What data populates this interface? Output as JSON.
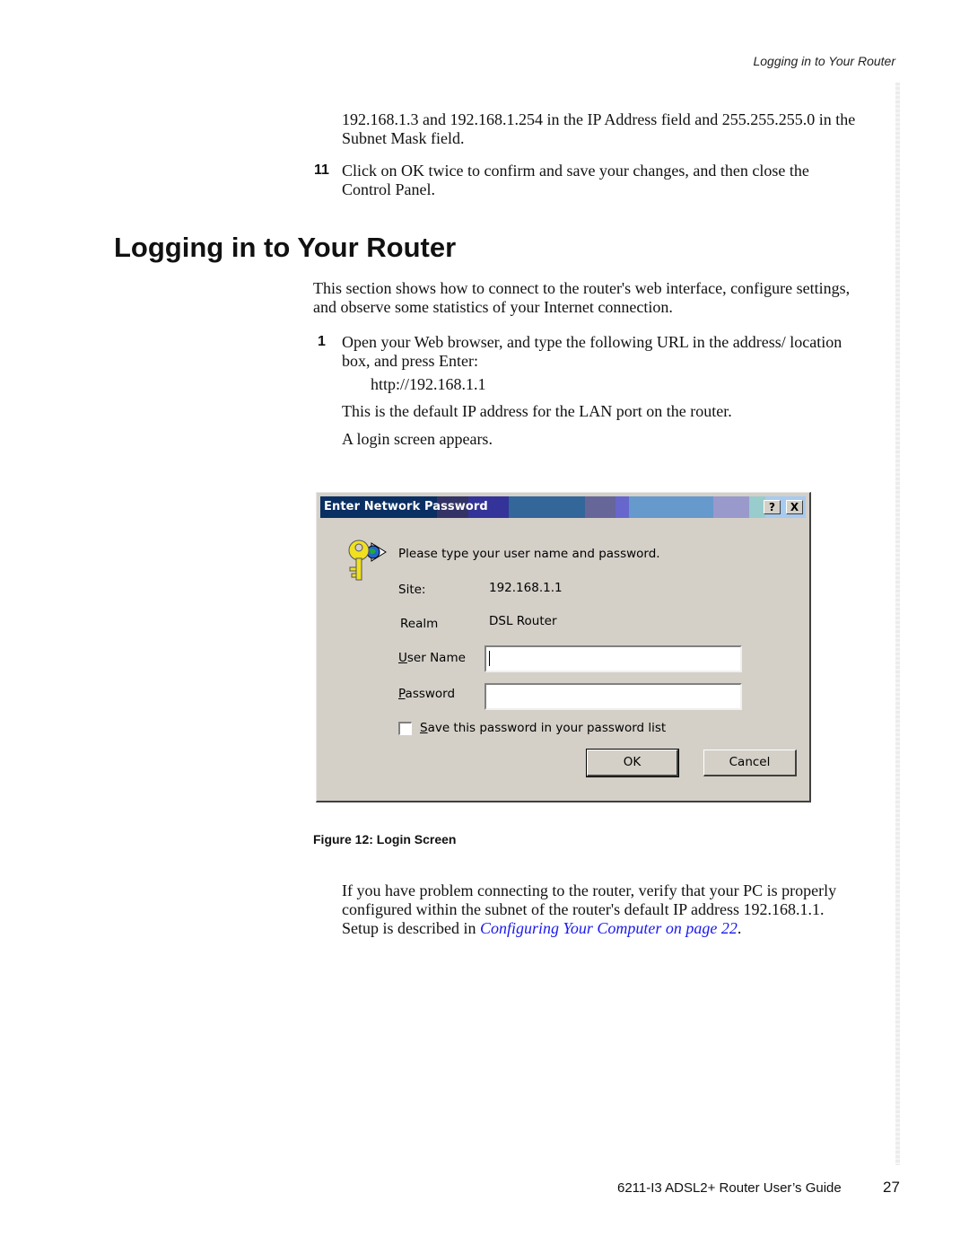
{
  "running_head": "Logging in to Your Router",
  "prev_section": {
    "continuation": "192.168.1.3 and 192.168.1.254 in the IP Address field and 255.255.255.0 in the Subnet Mask field.",
    "step_11": {
      "number": "11",
      "text": "Click on OK twice to confirm and save your changes, and then close the Control Panel."
    }
  },
  "section": {
    "title": "Logging in to Your Router",
    "intro": "This section shows how to connect to the router's web interface, configure settings, and observe some statistics of your Internet connection.",
    "step_1": {
      "number": "1",
      "text": "Open your Web browser, and type the following URL in the address/ location box, and press Enter:",
      "url": "http://192.168.1.1",
      "note1": "This is the default IP address for the LAN port on the router.",
      "note2": "A login screen appears."
    }
  },
  "dialog": {
    "title": "Enter Network Password",
    "help_button": "?",
    "close_button": "X",
    "prompt": "Please type your user name and password.",
    "site_label": "Site:",
    "site_value": "192.168.1.1",
    "realm_label": "Realm",
    "realm_value": "DSL Router",
    "username_label_u": "U",
    "username_label_rest": "ser Name",
    "username_value": "",
    "password_label_u": "P",
    "password_label_rest": "assword",
    "password_value": "",
    "save_label_u": "S",
    "save_label_rest": "ave this password in your password list",
    "save_checked": false,
    "ok_label": "OK",
    "cancel_label": "Cancel",
    "icon": "key-globe-icon"
  },
  "figure_caption": "Figure 12: Login Screen",
  "trouble": {
    "text_before": "If you have problem connecting to the router, verify that your PC is properly configured within the subnet of the router's default IP address 192.168.1.1. Setup is described in ",
    "link": "Configuring Your Computer on page 22",
    "text_after": "."
  },
  "footer": {
    "guide_title": "6211-I3 ADSL2+ Router User’s Guide",
    "page_number": "27"
  }
}
